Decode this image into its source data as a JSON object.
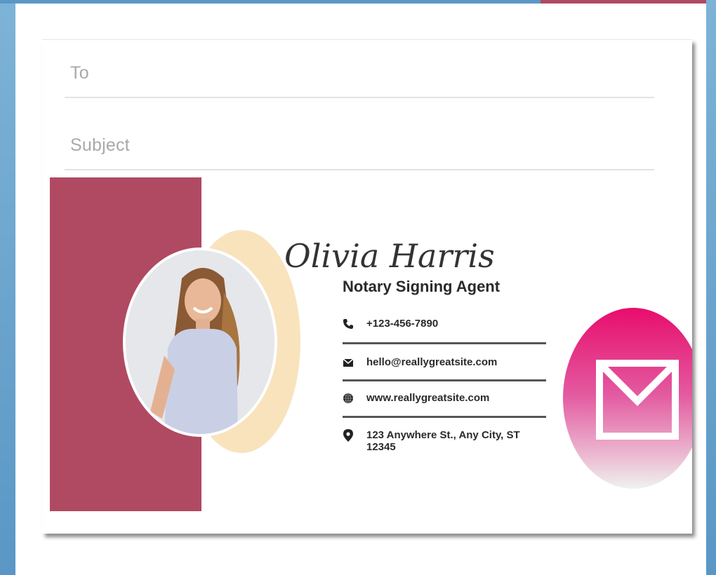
{
  "compose": {
    "to_placeholder": "To",
    "subject_placeholder": "Subject"
  },
  "signature": {
    "name": "Olivia Harris",
    "title": "Notary Signing Agent",
    "contacts": [
      {
        "icon": "phone-icon",
        "text": "+123-456-7890"
      },
      {
        "icon": "mail-icon",
        "text": "hello@reallygreatsite.com"
      },
      {
        "icon": "globe-icon",
        "text": "www.reallygreatsite.com"
      },
      {
        "icon": "location-pin-icon",
        "text": "123 Anywhere St., Any City, ST 12345"
      }
    ]
  },
  "colors": {
    "accent_block": "#b04a62",
    "ring": "#f9e3bd",
    "email_circle_top": "#e80d6d",
    "email_circle_bottom": "#eef2ee",
    "frame_blue": "#5a97c6"
  }
}
